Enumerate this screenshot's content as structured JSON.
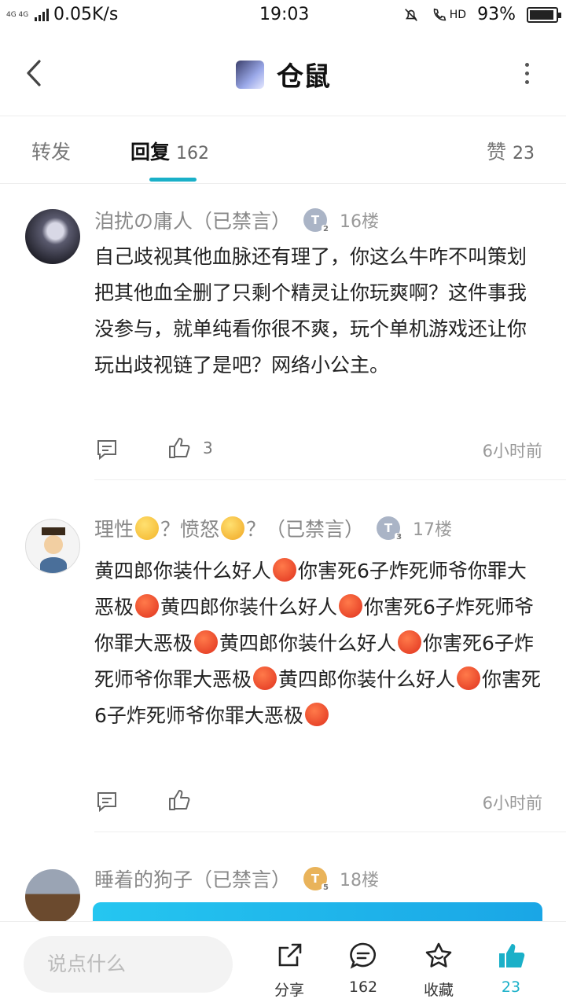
{
  "status_bar": {
    "network_type": "4G 4G",
    "speed": "0.05K/s",
    "time": "19:03",
    "hd_label": "HD",
    "battery": "93%",
    "battery_level": 0.93
  },
  "header": {
    "title": "仓鼠",
    "back_icon": "chevron-left-icon",
    "more_icon": "more-vertical-icon"
  },
  "tabs": {
    "forward": "转发",
    "reply": "回复",
    "reply_count": "162",
    "like": "赞",
    "like_count": "23"
  },
  "posts": [
    {
      "username": "洎扰の庸人（已禁言）",
      "level": "T",
      "level_sub": "2",
      "level_color": "#aab4c6",
      "floor": "16楼",
      "content": "自己歧视其他血脉还有理了，你这么牛咋不叫策划把其他血全删了只剩个精灵让你玩爽啊？这件事我没参与，就单纯看你很不爽，玩个单机游戏还让你玩出歧视链了是吧？网络小公主。",
      "likes": "3",
      "time": "6小时前"
    },
    {
      "username_parts": [
        "理性",
        "？愤怒",
        "？（已禁言）"
      ],
      "level": "T",
      "level_sub": "3",
      "level_color": "#aab4c6",
      "floor": "17楼",
      "content_segments": [
        "黄四郎你装什么好人",
        "你害死6子炸死师爷你罪大恶极",
        "黄四郎你装什么好人",
        "你害死6子炸死师爷你罪大恶极",
        "黄四郎你装什么好人",
        "你害死6子炸死师爷你罪大恶极",
        "黄四郎你装什么好人",
        "你害死6子炸死师爷你罪大恶极",
        ""
      ],
      "likes": "",
      "time": "6小时前"
    },
    {
      "username": "睡着的狗子（已禁言）",
      "level": "T",
      "level_sub": "5",
      "level_color": "#e9b35a",
      "floor": "18楼"
    }
  ],
  "bottom_bar": {
    "input_placeholder": "说点什么",
    "share": "分享",
    "comments": "162",
    "favorite": "收藏",
    "likes": "23",
    "accent_color": "#1ab0c8"
  }
}
